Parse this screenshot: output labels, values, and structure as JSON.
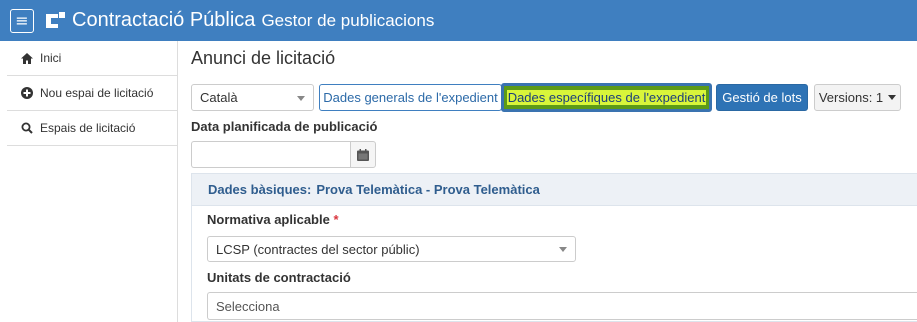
{
  "header": {
    "title": "Contractació Pública",
    "subtitle": "Gestor de publicacions",
    "menu_icon": "hamburger-icon",
    "logo": "brand-logo"
  },
  "sidebar": {
    "items": [
      {
        "icon": "home-icon",
        "label": "Inici"
      },
      {
        "icon": "plus-circle-icon",
        "label": "Nou espai de licitació"
      },
      {
        "icon": "search-icon",
        "label": "Espais de licitació"
      }
    ]
  },
  "main": {
    "title": "Anunci de licitació",
    "language_select": "Català",
    "tabs": {
      "general": "Dades generals de l'expedient",
      "specific": "Dades específiques de l'expedient",
      "lots": "Gestió de lots",
      "versions": "Versions: 1"
    },
    "date_label": "Data planificada de publicació",
    "date_value": "",
    "panel": {
      "prefix": "Dades bàsiques:",
      "title": "Prova Telemàtica - Prova Telemàtica"
    },
    "normativa_label": "Normativa aplicable",
    "normativa_required": "*",
    "normativa_value": "LCSP (contractes del sector públic)",
    "unitats_label": "Unitats de contractació",
    "unitats_placeholder": "Selecciona"
  },
  "colors": {
    "header_bg": "#3f7fc0",
    "primary": "#2e73b5",
    "highlight": "#d9f53a"
  }
}
